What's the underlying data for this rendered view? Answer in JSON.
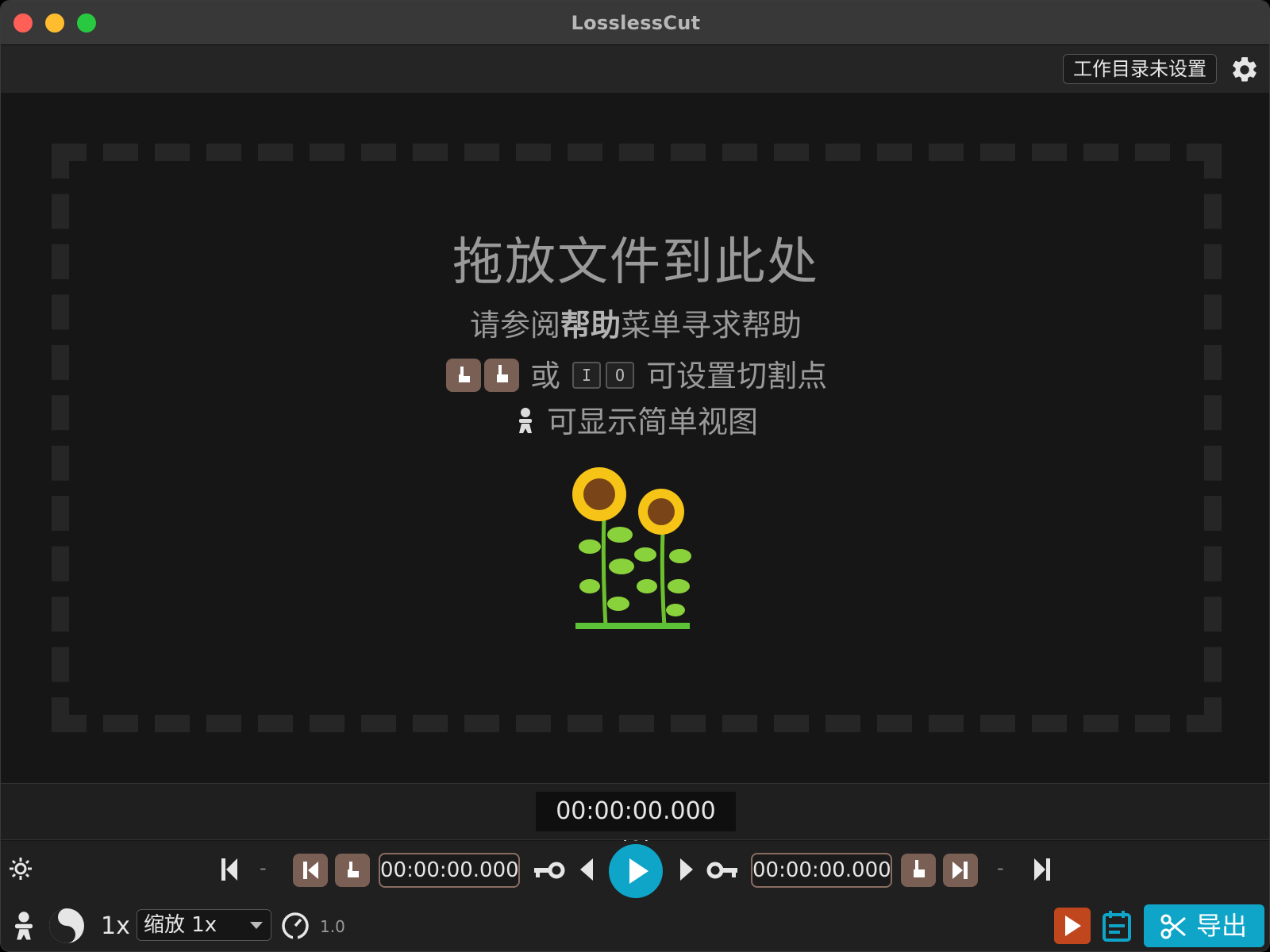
{
  "window": {
    "title": "LosslessCut"
  },
  "toolbar": {
    "workdir_label": "工作目录未设置"
  },
  "dropzone": {
    "title": "拖放文件到此处",
    "help_prefix": "请参阅",
    "help_bold": "帮助",
    "help_suffix": "菜单寻求帮助",
    "or_text": "或",
    "key_i": "I",
    "key_o": "O",
    "cutpoint_text": "可设置切割点",
    "simple_view_text": "可显示简单视图"
  },
  "timebar": {
    "current_time": "00:00:00.000 (0)"
  },
  "controls": {
    "dash_left": "-",
    "dash_right": "-",
    "start_time": "00:00:00.000",
    "end_time": "00:00:00.000",
    "speed_label": "1x",
    "zoom_value": "缩放 1x",
    "playback_rate": "1.0",
    "export_label": "导出"
  },
  "colors": {
    "accent": "#0ea5c9",
    "key_button": "#7a5f55",
    "export_preview": "#c0461e"
  }
}
